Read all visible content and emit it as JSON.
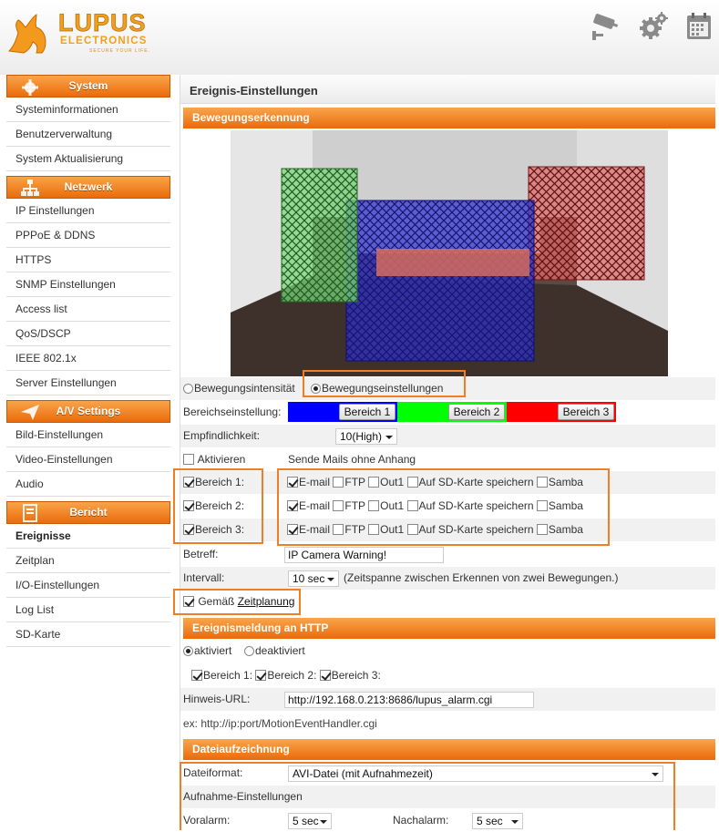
{
  "brand": {
    "name_line1": "LUPUS",
    "name_line2": "ELECTRONICS",
    "tagline": "SECURE YOUR LIFE."
  },
  "header_icons": [
    "camera-icon",
    "gear-icon",
    "calendar-icon"
  ],
  "colors": {
    "accent": "#ef7a1a",
    "bereich1": "#0000ff",
    "bereich2": "#00ff00",
    "bereich3": "#ff0000"
  },
  "sidebar": {
    "system": {
      "title": "System",
      "items": [
        "Systeminformationen",
        "Benutzerverwaltung",
        "System Aktualisierung"
      ]
    },
    "netzwerk": {
      "title": "Netzwerk",
      "items": [
        "IP Einstellungen",
        "PPPoE & DDNS",
        "HTTPS",
        "SNMP Einstellungen",
        "Access list",
        "QoS/DSCP",
        "IEEE 802.1x",
        "Server Einstellungen"
      ]
    },
    "av": {
      "title": "A/V Settings",
      "items": [
        "Bild-Einstellungen",
        "Video-Einstellungen",
        "Audio"
      ]
    },
    "bericht": {
      "title": "Bericht",
      "items": [
        "Ereignisse",
        "Zeitplan",
        "I/O-Einstellungen",
        "Log List",
        "SD-Karte"
      ]
    }
  },
  "page": {
    "title": "Ereignis-Einstellungen",
    "motion": {
      "section_title": "Bewegungserkennung",
      "radio_intensity": "Bewegungsintensität",
      "radio_settings": "Bewegungseinstellungen",
      "area_label": "Bereichseinstellung:",
      "area_buttons": [
        "Bereich 1",
        "Bereich 2",
        "Bereich 3"
      ],
      "sensitivity_label": "Empfindlichkeit:",
      "sensitivity_value": "10(High)",
      "activate_label": "Aktivieren",
      "mail_note": "Sende Mails ohne Anhang",
      "area_rows": [
        {
          "label": "Bereich 1:",
          "checked": true
        },
        {
          "label": "Bereich 2:",
          "checked": true
        },
        {
          "label": "Bereich 3:",
          "checked": true
        }
      ],
      "actions": {
        "email": "E-mail",
        "ftp": "FTP",
        "out1": "Out1",
        "sd": "Auf SD-Karte speichern",
        "samba": "Samba"
      },
      "subject_label": "Betreff:",
      "subject_value": "IP Camera Warning!",
      "interval_label": "Intervall:",
      "interval_value": "10 sec",
      "interval_note": "(Zeitspanne zwischen Erkennen von zwei Bewegungen.)",
      "schedule_prefix": "Gemäß",
      "schedule_link": "Zeitplanung"
    },
    "http": {
      "section_title": "Ereignismeldung an HTTP",
      "on_label": "aktiviert",
      "off_label": "deaktiviert",
      "areas": [
        "Bereich 1:",
        "Bereich 2:",
        "Bereich 3:"
      ],
      "url_label": "Hinweis-URL:",
      "url_value": "http://192.168.0.213:8686/lupus_alarm.cgi",
      "example": "ex: http://ip:port/MotionEventHandler.cgi"
    },
    "recording": {
      "section_title": "Dateiaufzeichnung",
      "format_label": "Dateiformat:",
      "format_value": "AVI-Datei (mit Aufnahmezeit)",
      "settings_label": "Aufnahme-Einstellungen",
      "prealarm_label": "Voralarm:",
      "prealarm_value": "5 sec",
      "postalarm_label": "Nachalarm:",
      "postalarm_value": "5 sec"
    }
  }
}
